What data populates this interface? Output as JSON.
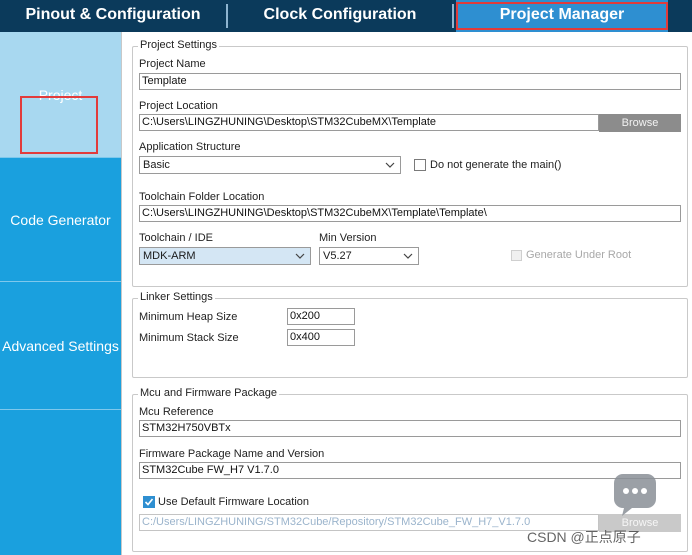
{
  "tabs": [
    {
      "label": "Pinout & Configuration"
    },
    {
      "label": "Clock Configuration"
    },
    {
      "label": "Project Manager"
    }
  ],
  "sidebar": {
    "items": [
      {
        "label": "Project",
        "active": true
      },
      {
        "label": "Code Generator",
        "active": false
      },
      {
        "label": "Advanced Settings",
        "active": false
      }
    ]
  },
  "project_settings": {
    "legend": "Project Settings",
    "name_label": "Project Name",
    "name_value": "Template",
    "location_label": "Project Location",
    "location_value": "C:\\Users\\LINGZHUNING\\Desktop\\STM32CubeMX\\Template",
    "browse_label": "Browse",
    "app_structure_label": "Application Structure",
    "app_structure_value": "Basic",
    "no_main_label": "Do not generate the main()",
    "no_main_checked": false,
    "toolchain_folder_label": "Toolchain Folder Location",
    "toolchain_folder_value": "C:\\Users\\LINGZHUNING\\Desktop\\STM32CubeMX\\Template\\Template\\",
    "toolchain_label": "Toolchain / IDE",
    "toolchain_value": "MDK-ARM",
    "min_version_label": "Min Version",
    "min_version_value": "V5.27",
    "gen_under_root_label": "Generate Under Root",
    "gen_under_root_checked": false
  },
  "linker_settings": {
    "legend": "Linker Settings",
    "heap_label": "Minimum Heap Size",
    "heap_value": "0x200",
    "stack_label": "Minimum Stack Size",
    "stack_value": "0x400"
  },
  "mcu_firmware": {
    "legend": "Mcu and Firmware Package",
    "mcu_ref_label": "Mcu Reference",
    "mcu_ref_value": "STM32H750VBTx",
    "fw_label": "Firmware Package Name and Version",
    "fw_value": "STM32Cube FW_H7 V1.7.0",
    "use_default_label": "Use Default Firmware Location",
    "use_default_checked": true,
    "fw_location_value": "C:/Users/LINGZHUNING/STM32Cube/Repository/STM32Cube_FW_H7_V1.7.0",
    "browse_label": "Browse"
  },
  "watermark": {
    "text": "CSDN @正点原子"
  },
  "colors": {
    "tabbar": "#0b3a5b",
    "active_tab": "#2e8fd1",
    "sidebar": "#1aa0de",
    "sidebar_active": "#a8d8f0",
    "highlight_box": "#e23b3b"
  }
}
